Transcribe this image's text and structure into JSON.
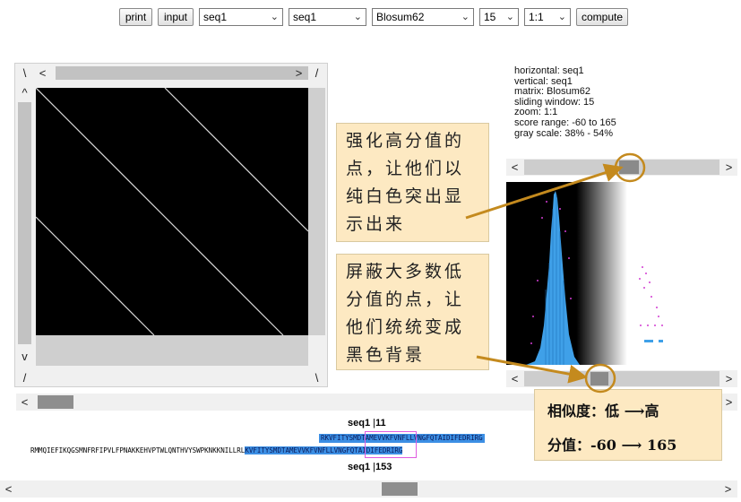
{
  "toolbar": {
    "print_label": "print",
    "input_label": "input",
    "seq_h": "seq1",
    "seq_v": "seq1",
    "matrix": "Blosum62",
    "window": "15",
    "zoom": "1:1",
    "compute_label": "compute"
  },
  "info": {
    "horizontal": "horizontal: seq1",
    "vertical": "vertical: seq1",
    "matrix": "matrix: Blosum62",
    "window": "sliding window: 15",
    "zoom": "zoom: 1:1",
    "score_range": "score range: -60 to 165",
    "gray_scale": "gray scale: 38% - 54%"
  },
  "callouts": {
    "top": [
      "强化高分值的",
      "点，让他们以",
      "纯白色突出显",
      "示出来"
    ],
    "bottom": [
      "屏蔽大多数低",
      "分值的点，让",
      "他们统统变成",
      "黑色背景"
    ]
  },
  "legend": {
    "similarity": "相似度：低 ⟶高",
    "score": "分值：-60 ⟶ 165"
  },
  "alignment": {
    "top_label_name": "seq1",
    "top_label_pos": "11",
    "bottom_label_name": "seq1",
    "bottom_label_pos": "153",
    "top_seq": "RKVFITYSMDTAMEVVKFVNFLLVNGFQTAIDIFEDRIRG",
    "bottom_prefix": "RMMQIEFIKQGSMNFRFIPVLFPNAKKEHVPTWLQNTHVYSWPKNKKNILLRL",
    "bottom_seq": "KVFITYSMDTAMEVVKFVNFLLVNGFQTAIDIFEDRIRG"
  },
  "arrows": {
    "left": "<",
    "right": ">",
    "up": "^",
    "down": "v",
    "tick_left": "/",
    "tick_right": "\\",
    "tick_bottom_left": "/",
    "tick_bottom_right": "\\",
    "corner_left": "\\"
  }
}
